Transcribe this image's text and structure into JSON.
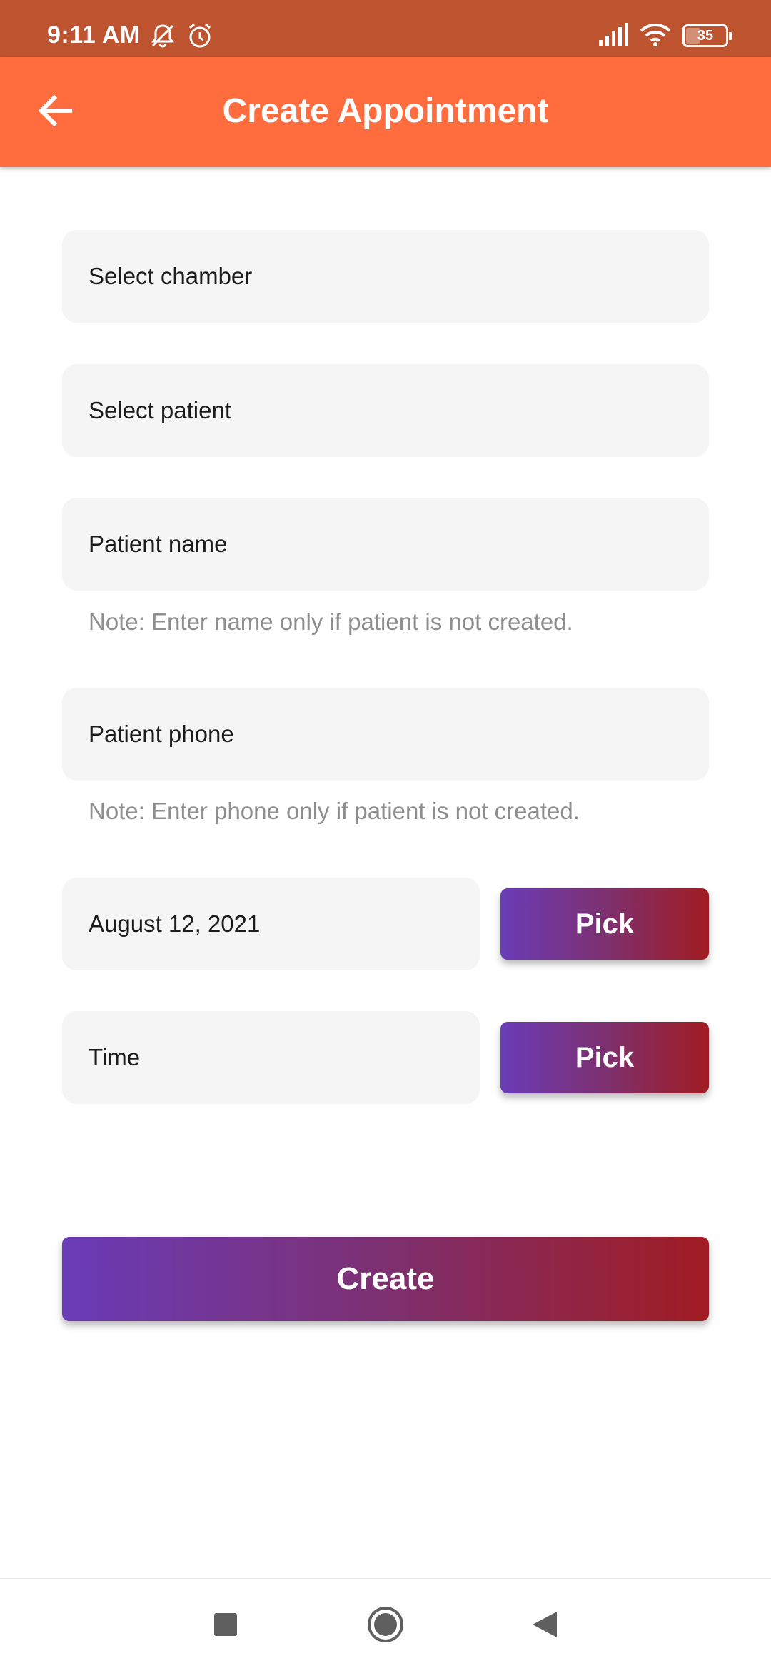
{
  "status_bar": {
    "time": "9:11 AM",
    "battery": "35",
    "icons": [
      "bell-off-icon",
      "alarm-icon",
      "signal-icon",
      "wifi-icon",
      "battery-icon"
    ]
  },
  "app_bar": {
    "title": "Create Appointment",
    "back_icon": "arrow-back-icon"
  },
  "form": {
    "chamber": {
      "placeholder": "Select chamber"
    },
    "patient": {
      "placeholder": "Select patient"
    },
    "patient_name": {
      "placeholder": "Patient name",
      "note": "Note: Enter name only if patient is not created."
    },
    "patient_phone": {
      "placeholder": "Patient phone",
      "note": "Note: Enter phone only if patient is not created."
    },
    "date": {
      "value": "August 12, 2021",
      "pick_label": "Pick"
    },
    "time": {
      "placeholder": "Time",
      "pick_label": "Pick"
    },
    "create_label": "Create"
  },
  "colors": {
    "status_bar": "#BE5330",
    "app_bar": "#FF6D3F",
    "field_bg": "#F5F5F5",
    "gradient_start": "#6A3CB8",
    "gradient_end": "#A11C22",
    "note_text": "#8E8E8E"
  },
  "nav_bar": {
    "icons": [
      "recents-square-icon",
      "home-circle-icon",
      "back-triangle-icon"
    ]
  }
}
